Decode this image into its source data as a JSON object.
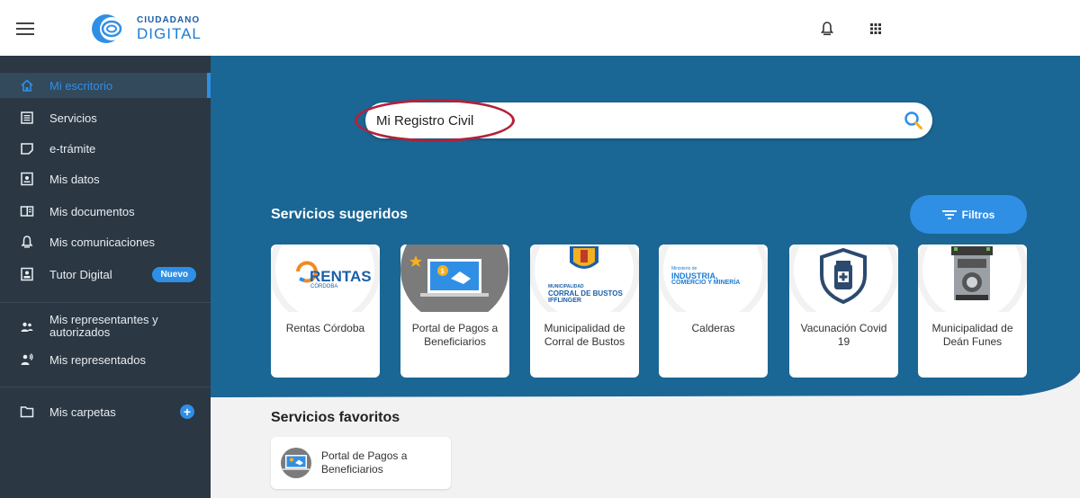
{
  "app": {
    "logo_top": "CIUDADANO",
    "logo_bottom": "DIGITAL"
  },
  "topbar": {
    "notifications_icon": "bell-icon",
    "apps_icon": "grid-icon"
  },
  "sidebar": {
    "items": [
      {
        "label": "Mi escritorio",
        "icon": "home-icon",
        "active": true
      },
      {
        "label": "Servicios",
        "icon": "list-icon"
      },
      {
        "label": "e-trámite",
        "icon": "document-icon"
      },
      {
        "label": "Mis datos",
        "icon": "id-card-icon"
      },
      {
        "label": "Mis documentos",
        "icon": "documents-icon"
      },
      {
        "label": "Mis comunicaciones",
        "icon": "bell-icon"
      },
      {
        "label": "Tutor Digital",
        "icon": "badge-icon",
        "badge": "Nuevo"
      },
      {
        "label_line1": "Mis representantes y",
        "label_line2": "autorizados",
        "icon": "people-icon"
      },
      {
        "label": "Mis representados",
        "icon": "person-voice-icon"
      },
      {
        "label": "Mis carpetas",
        "icon": "folder-icon",
        "action": "+"
      }
    ]
  },
  "search": {
    "value": "Mi Registro Civil",
    "placeholder": ""
  },
  "suggested": {
    "title": "Servicios sugeridos",
    "filter_label": "Filtros",
    "cards": [
      {
        "name": "Rentas Córdoba",
        "logo_text": "RENTAS",
        "logo_sub": "CÓRDOBA"
      },
      {
        "name": "Portal de Pagos a Beneficiarios"
      },
      {
        "name": "Municipalidad de Corral de Bustos",
        "logo_line1": "MUNICIPALIDAD",
        "logo_line2": "CORRAL DE BUSTOS",
        "logo_line3": "IFFLINGER"
      },
      {
        "name": "Calderas",
        "logo_line1": "Ministerio de",
        "logo_line2": "INDUSTRIA,",
        "logo_line3": "COMERCIO Y MINERÍA"
      },
      {
        "name": "Vacunación Covid 19"
      },
      {
        "name": "Municipalidad de Deán Funes"
      }
    ]
  },
  "favorites": {
    "title": "Servicios favoritos",
    "items": [
      {
        "name": "Portal de Pagos a Beneficiarios"
      }
    ]
  },
  "colors": {
    "hero": "#1a6694",
    "sidebar": "#2b3743",
    "accent": "#2f8fe5",
    "annotation": "#b2223a"
  }
}
